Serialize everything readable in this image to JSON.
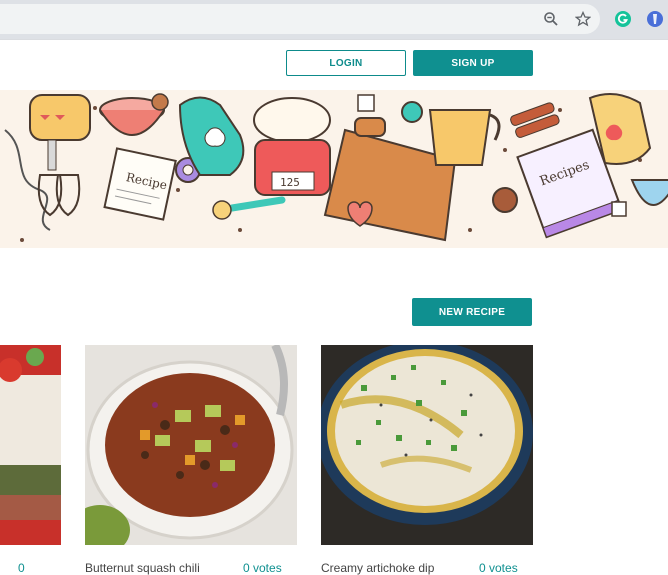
{
  "browser": {
    "icons": [
      "zoom-icon",
      "star-icon",
      "grammarly-icon",
      "extension-icon"
    ]
  },
  "header": {
    "login_label": "LOGIN",
    "signup_label": "SIGN UP"
  },
  "banner": {
    "book_label": "Recipes",
    "card_label": "Recipe",
    "scale_reading": "125"
  },
  "actions": {
    "new_recipe_label": "NEW RECIPE"
  },
  "recipes": [
    {
      "title": "",
      "votes": "0"
    },
    {
      "title": "Butternut squash chili",
      "votes": "0 votes"
    },
    {
      "title": "Creamy artichoke dip",
      "votes": "0 votes"
    }
  ],
  "colors": {
    "accent": "#0f9090",
    "banner_bg": "#fbf3ea"
  }
}
